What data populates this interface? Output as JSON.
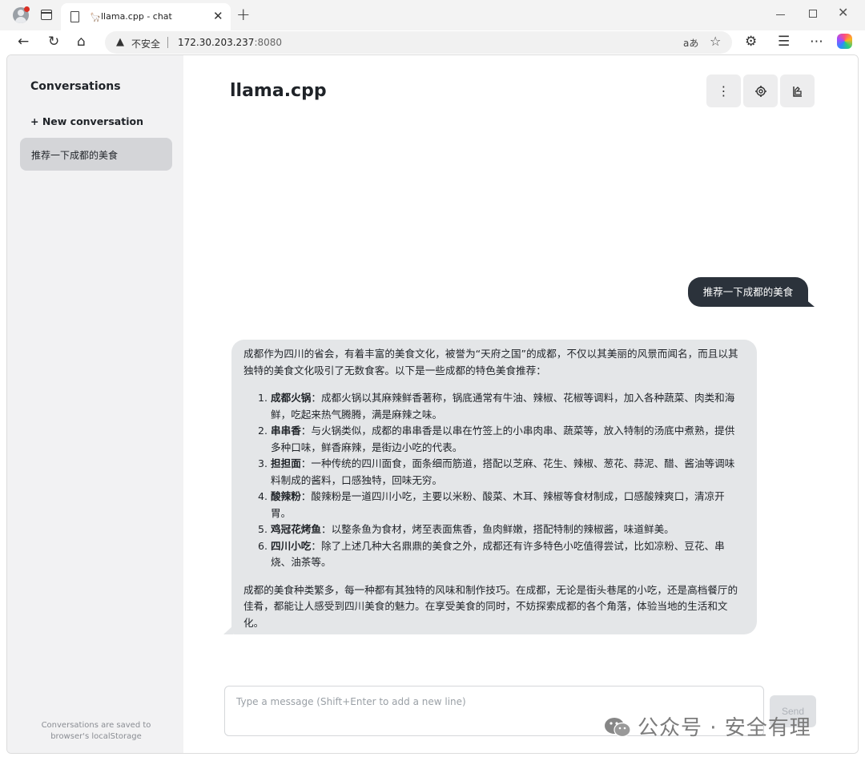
{
  "browser": {
    "tab_title": "llama.cpp - chat",
    "tab_favicon": "llama-icon",
    "insecure_label": "不安全",
    "url_host": "172.30.203.237",
    "url_port": ":8080",
    "read_aloud_glyph": "aあ"
  },
  "sidebar": {
    "title": "Conversations",
    "new_conversation": "+ New conversation",
    "conversations": [
      {
        "label": "推荐一下成都的美食",
        "active": true
      }
    ],
    "footer": "Conversations are saved to browser's localStorage"
  },
  "header": {
    "title": "llama.cpp",
    "buttons": [
      "more-vertical-icon",
      "gear-icon",
      "theme-icon"
    ]
  },
  "messages": {
    "user": "推荐一下成都的美食",
    "assistant": {
      "intro": "成都作为四川的省会，有着丰富的美食文化，被誉为“天府之国”的成都，不仅以其美丽的风景而闻名，而且以其独特的美食文化吸引了无数食客。以下是一些成都的特色美食推荐：",
      "items": [
        {
          "name": "成都火锅",
          "desc": "：成都火锅以其麻辣鲜香著称，锅底通常有牛油、辣椒、花椒等调料，加入各种蔬菜、肉类和海鲜，吃起来热气腾腾，满是麻辣之味。"
        },
        {
          "name": "串串香",
          "desc": "：与火锅类似，成都的串串香是以串在竹签上的小串肉串、蔬菜等，放入特制的汤底中煮熟，提供多种口味，鲜香麻辣，是街边小吃的代表。"
        },
        {
          "name": "担担面",
          "desc": "：一种传统的四川面食，面条细而筋道，搭配以芝麻、花生、辣椒、葱花、蒜泥、醋、酱油等调味料制成的酱料，口感独特，回味无穷。"
        },
        {
          "name": "酸辣粉",
          "desc": "：酸辣粉是一道四川小吃，主要以米粉、酸菜、木耳、辣椒等食材制成，口感酸辣爽口，清凉开胃。"
        },
        {
          "name": "鸡冠花烤鱼",
          "desc": "：以整条鱼为食材，烤至表面焦香，鱼肉鲜嫩，搭配特制的辣椒酱，味道鲜美。"
        },
        {
          "name": "四川小吃",
          "desc": "：除了上述几种大名鼎鼎的美食之外，成都还有许多特色小吃值得尝试，比如凉粉、豆花、串烧、油茶等。"
        }
      ],
      "outro": "成都的美食种类繁多，每一种都有其独特的风味和制作技巧。在成都，无论是街头巷尾的小吃，还是高档餐厅的佳肴，都能让人感受到四川美食的魅力。在享受美食的同时，不妨探索成都的各个角落，体验当地的生活和文化。"
    }
  },
  "composer": {
    "placeholder": "Type a message (Shift+Enter to add a new line)",
    "send_label": "Send"
  },
  "watermark": "公众号 · 安全有理",
  "colors": {
    "sidebar_bg": "#f2f2f3",
    "active_conv": "#d4d5d8",
    "user_bubble": "#2b323b",
    "assistant_bubble": "#e4e6e8"
  }
}
